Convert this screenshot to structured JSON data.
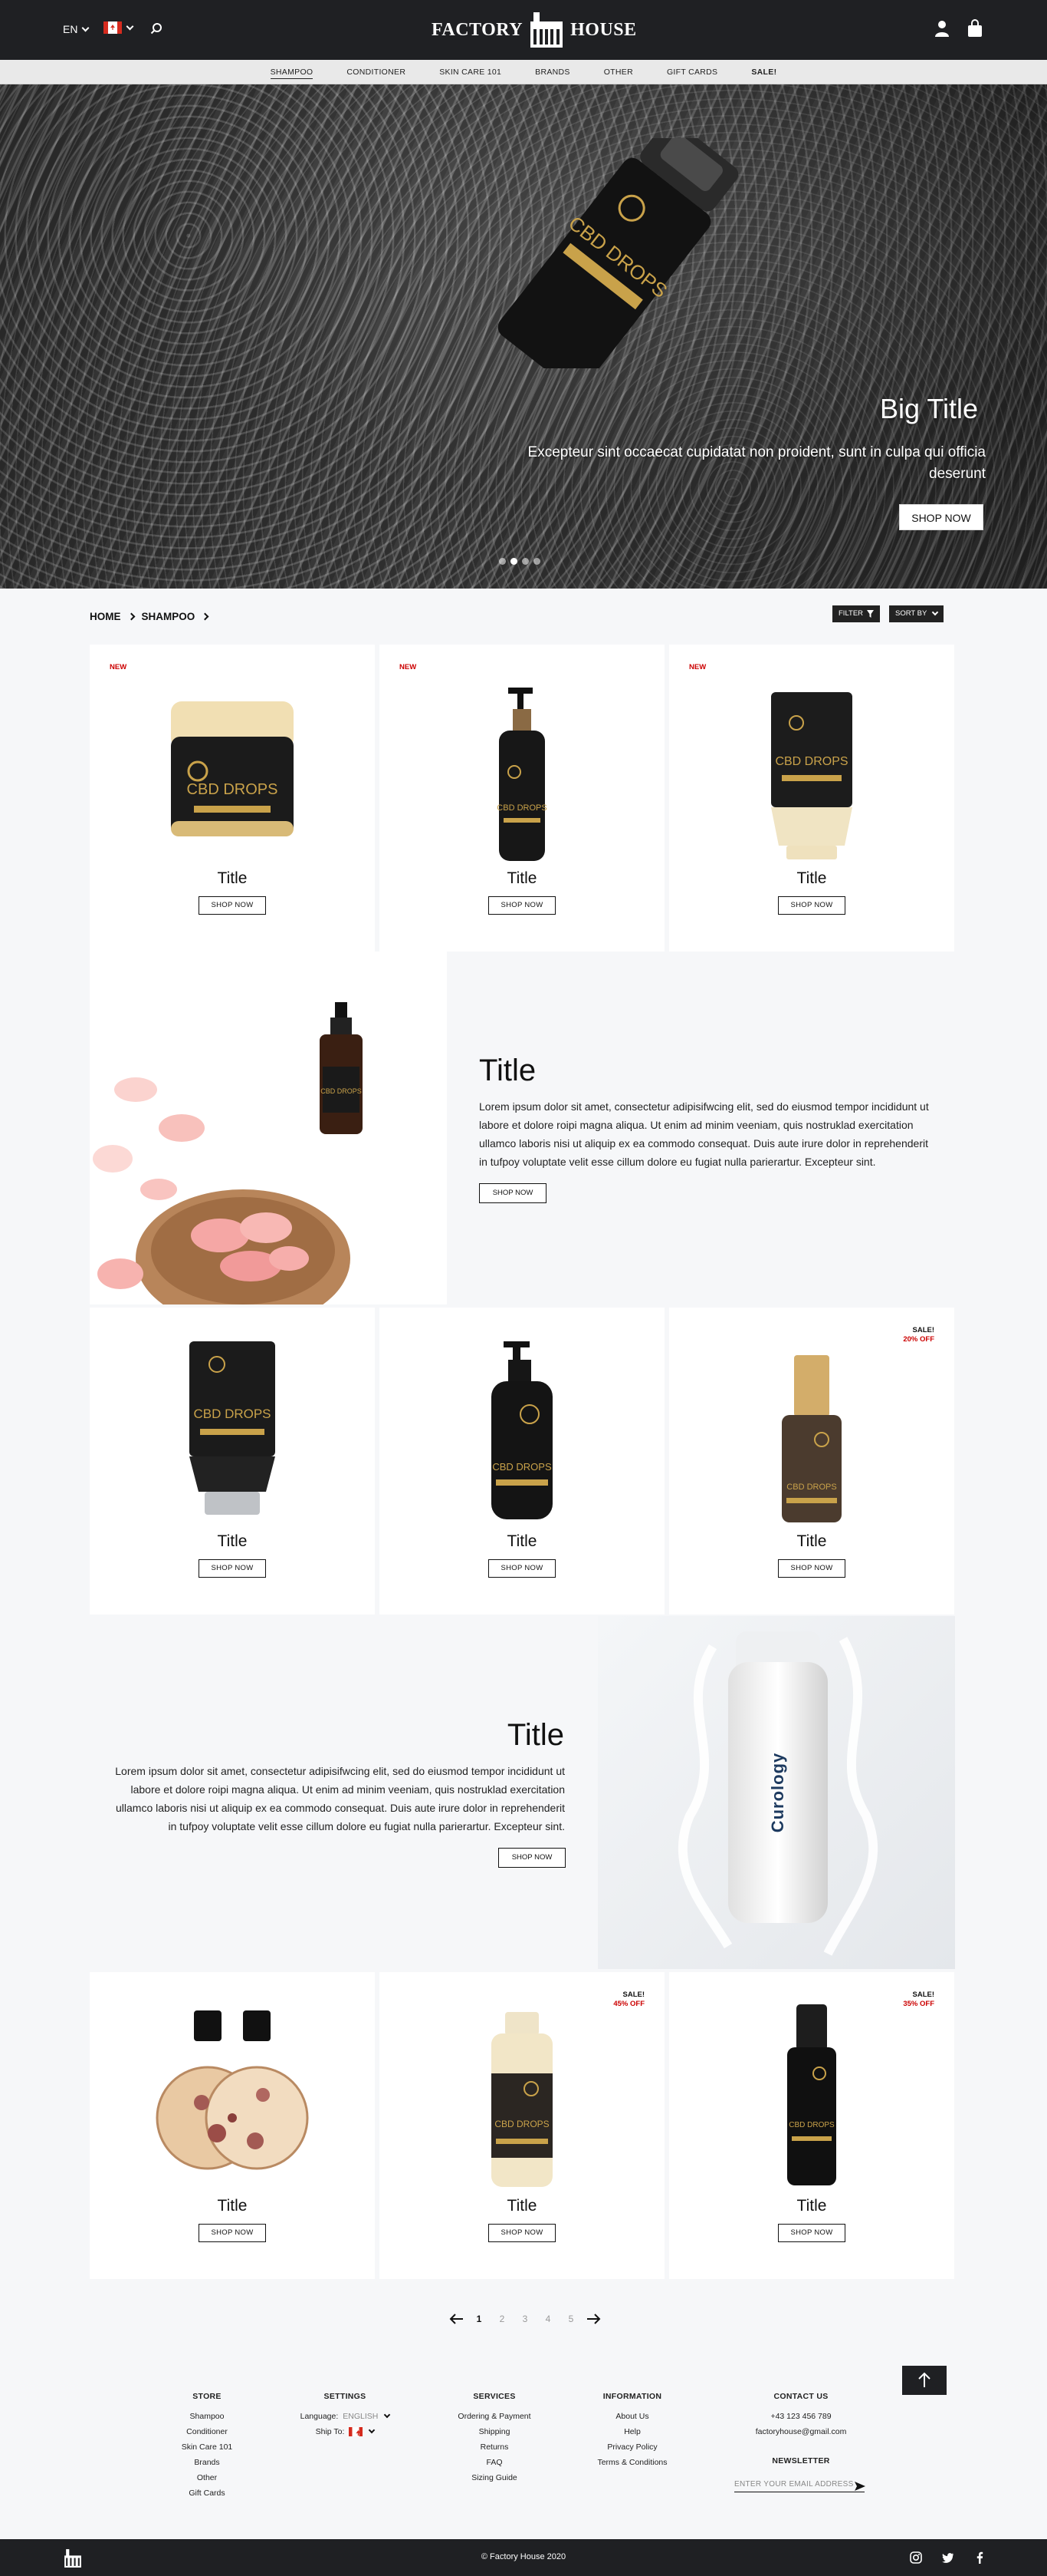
{
  "header": {
    "language": "EN",
    "brand_left": "FACTORY",
    "brand_right": "HOUSE"
  },
  "nav": {
    "items": [
      "SHAMPOO",
      "CONDITIONER",
      "SKIN CARE 101",
      "BRANDS",
      "OTHER",
      "GIFT CARDS",
      "SALE!"
    ],
    "active": "SHAMPOO"
  },
  "hero": {
    "title": "Big Title",
    "subtitle": "Excepteur sint occaecat cupidatat non proident, sunt in culpa qui officia deserunt",
    "button": "SHOP NOW",
    "slides": 4,
    "current_slide": 2
  },
  "breadcrumb": {
    "home": "HOME",
    "current": "SHAMPOO"
  },
  "toolbar": {
    "filter": "FILTER",
    "sort": "SORT BY"
  },
  "products": [
    {
      "title": "Title",
      "button": "SHOP NOW",
      "badge": "NEW",
      "image": "cbd-jar"
    },
    {
      "title": "Title",
      "button": "SHOP NOW",
      "badge": "NEW",
      "image": "cbd-pump-bottle"
    },
    {
      "title": "Title",
      "button": "SHOP NOW",
      "badge": "NEW",
      "image": "cbd-tube"
    },
    {
      "title": "Title",
      "button": "SHOP NOW",
      "image": "cbd-tube-black"
    },
    {
      "title": "Title",
      "button": "SHOP NOW",
      "image": "cbd-pump-bottle-round"
    },
    {
      "title": "Title",
      "button": "SHOP NOW",
      "sale": "SALE!",
      "discount": "20% OFF",
      "image": "cbd-serum"
    },
    {
      "title": "Title",
      "button": "SHOP NOW",
      "image": "twin-bottles"
    },
    {
      "title": "Title",
      "button": "SHOP NOW",
      "sale": "SALE!",
      "discount": "45% OFF",
      "image": "cbd-cream-bottle"
    },
    {
      "title": "Title",
      "button": "SHOP NOW",
      "sale": "SALE!",
      "discount": "35% OFF",
      "image": "cbd-pump-black"
    }
  ],
  "features": [
    {
      "title": "Title",
      "text": "Lorem ipsum dolor sit amet, consectetur adipisifwcing elit, sed do eiusmod tempor incididunt ut labore et dolore roipi magna aliqua. Ut enim ad minim veeniam, quis nostruklad exercitation ullamco laboris nisi ut aliquip ex ea commodo consequat. Duis aute irure dolor in reprehenderit in tufpoy voluptate velit esse cillum dolore eu fugiat nulla parierartur. Excepteur sint.",
      "button": "SHOP NOW"
    },
    {
      "title": "Title",
      "text": "Lorem ipsum dolor sit amet, consectetur adipisifwcing elit, sed do eiusmod tempor incididunt ut labore et dolore roipi magna aliqua. Ut enim ad minim veeniam, quis nostruklad exercitation ullamco laboris nisi ut aliquip ex ea commodo consequat. Duis aute irure dolor in reprehenderit in tufpoy voluptate velit esse cillum dolore eu fugiat nulla parierartur. Excepteur sint.",
      "button": "SHOP NOW",
      "product_label": "Curology"
    }
  ],
  "pagination": {
    "pages": [
      "1",
      "2",
      "3",
      "4",
      "5"
    ],
    "current": "1"
  },
  "footer": {
    "store": {
      "heading": "STORE",
      "links": [
        "Shampoo",
        "Conditioner",
        "Skin Care 101",
        "Brands",
        "Other",
        "Gift Cards"
      ]
    },
    "settings": {
      "heading": "SETTINGS",
      "language_label": "Language:",
      "language_value": "ENGLISH",
      "ship_label": "Ship To:"
    },
    "services": {
      "heading": "SERVICES",
      "links": [
        "Ordering & Payment",
        "Shipping",
        "Returns",
        "FAQ",
        "Sizing Guide"
      ]
    },
    "information": {
      "heading": "INFORMATION",
      "links": [
        "About Us",
        "Help",
        "Privacy Policy",
        "Terms & Conditions"
      ]
    },
    "contact": {
      "heading": "CONTACT US",
      "phone": "+43 123 456 789",
      "email": "factoryhouse@gmail.com"
    },
    "newsletter": {
      "heading": "NEWSLETTER",
      "placeholder": "ENTER YOUR EMAIL ADDRESS"
    },
    "copyright": "© Factory House 2020",
    "social": [
      "instagram-icon",
      "twitter-icon",
      "facebook-icon"
    ]
  },
  "colors": {
    "dark": "#1f2023",
    "sale_red": "#cc0000",
    "background": "#f6f7f9",
    "product_gold": "#c9a24a"
  }
}
